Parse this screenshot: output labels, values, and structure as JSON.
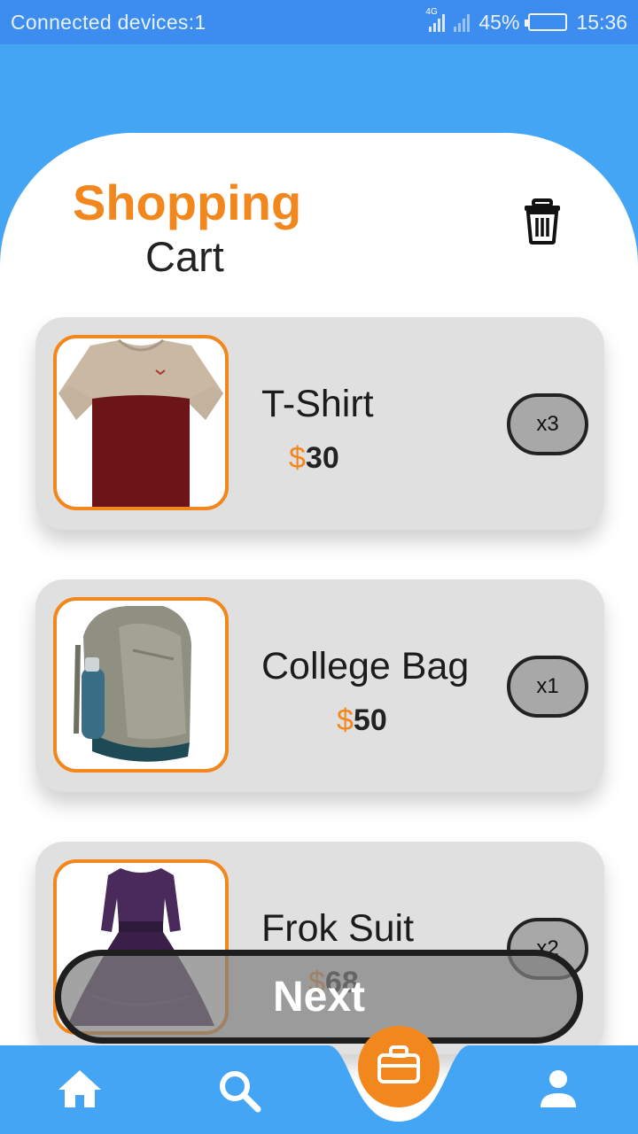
{
  "status_bar": {
    "left_text": "Connected devices:1",
    "battery": "45%",
    "time": "15:36",
    "network": "4G"
  },
  "header": {
    "title_main": "Shopping",
    "title_sub": "Cart"
  },
  "cart_items": [
    {
      "name": "T-Shirt",
      "currency": "$",
      "price": "30",
      "qty": "x3"
    },
    {
      "name": "College Bag",
      "currency": "$",
      "price": "50",
      "qty": "x1"
    },
    {
      "name": "Frok Suit",
      "currency": "$",
      "price": "68",
      "qty": "x2"
    }
  ],
  "actions": {
    "next_label": "Next"
  },
  "colors": {
    "accent": "#f2871d",
    "primary": "#44a5f5",
    "card": "#e0e0e0"
  },
  "nav": [
    "home-icon",
    "search-icon",
    "briefcase-icon",
    "user-icon"
  ]
}
